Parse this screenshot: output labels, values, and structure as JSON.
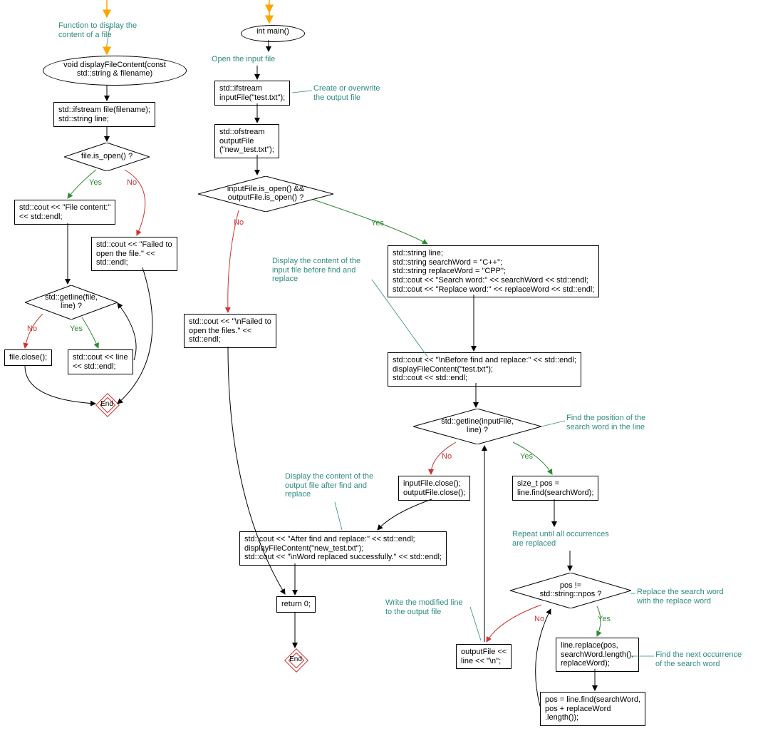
{
  "left": {
    "comment_fn": "Function to display the\ncontent of a file",
    "terminator": "void displayFileContent(const\nstd::string & filename)",
    "box_vars": "std::ifstream file(filename);\nstd::string line;",
    "dec_open": "file.is_open() ?",
    "yes": "Yes",
    "no": "No",
    "box_content": "std::cout << \"File content:\"\n<< std::endl;",
    "box_failed": "std::cout << \"Failed to\nopen the file.\" <<\nstd::endl;",
    "dec_getline": "std::getline(file,\nline) ?",
    "box_close": "file.close();",
    "box_coutline": "std::cout << line\n<< std::endl;",
    "end": "End"
  },
  "right": {
    "terminator": "int main()",
    "comment_open": "Open the input file",
    "box_ifstream": "std::ifstream\ninputFile(\"test.txt\");",
    "comment_create": "Create or overwrite\nthe output file",
    "box_ofstream": "std::ofstream\noutputFile\n(\"new_test.txt\");",
    "dec_bothopen": "inputFile.is_open() &&\noutputFile.is_open() ?",
    "no": "No",
    "yes": "Yes",
    "comment_displaybefore": "Display the content of the\ninput file before find and\nreplace",
    "box_failedfiles": "std::cout << \"\\nFailed to\nopen the files.\" <<\nstd::endl;",
    "box_searchvars": "std::string line;\nstd::string searchWord = \"C++\";\nstd::string replaceWord = \"CPP\";\nstd::cout << \"Search word:\" << searchWord << std::endl;\nstd::cout << \"Replace word:\" << replaceWord << std::endl;",
    "box_before": "std::cout << \"\\nBefore find and replace:\" << std::endl;\ndisplayFileContent(\"test.txt\");\nstd::cout << std::endl;",
    "dec_getline2": "std::getline(inputFile,\nline) ?",
    "comment_findpos": "Find the position of the\nsearch word in the line",
    "box_close2": "inputFile.close();\noutputFile.close();",
    "box_pos": "size_t pos =\nline.find(searchWord);",
    "comment_repeat": "Repeat until all occurrences\nare replaced",
    "comment_displayafter": "Display the content of the\noutput file after find and\nreplace",
    "box_after": "std::cout << \"After find and replace:\" << std::endl;\ndisplayFileContent(\"new_test.txt\");\nstd::cout << \"\\nWord replaced successfully.\" << std::endl;",
    "box_return": "return 0;",
    "end": "End",
    "comment_writeline": "Write the modified line\nto the output file",
    "dec_npos": "pos !=\nstd::string::npos ?",
    "comment_replaceword": "Replace the search word\nwith the replace word",
    "box_outline": "outputFile <<\nline << \"\\n\";",
    "box_replace": "line.replace(pos,\nsearchWord.length(),\nreplaceWord);",
    "comment_findnext": "Find the next occurrence\nof the search word",
    "box_posnext": "pos = line.find(searchWord,\npos + replaceWord\n.length());"
  }
}
